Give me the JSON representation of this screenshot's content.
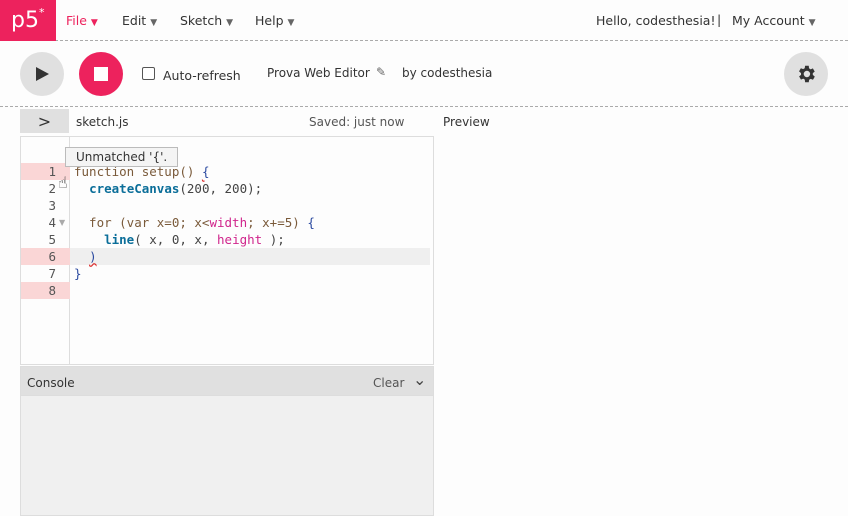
{
  "nav": {
    "logo": "p5",
    "logo_star": "*",
    "menus": [
      "File",
      "Edit",
      "Sketch",
      "Help"
    ],
    "hello": "Hello, codesthesia!",
    "separator": "|",
    "account": "My Account"
  },
  "toolbar": {
    "auto_refresh": "Auto-refresh",
    "auto_refresh_checked": false,
    "project_name": "Prova Web Editor",
    "by": "by codesthesia"
  },
  "editor": {
    "toggle": ">",
    "file_name": "sketch.js",
    "saved": "Saved: just now",
    "preview": "Preview",
    "tooltip": "Unmatched '{'.",
    "error_lines": [
      1,
      6,
      8
    ],
    "highlight_line": 6,
    "lines": [
      [
        {
          "t": "function setup() ",
          "c": "kw"
        },
        {
          "t": "{",
          "c": "br err"
        }
      ],
      [
        {
          "t": "  "
        },
        {
          "t": "createCanvas",
          "c": "fn"
        },
        {
          "t": "(200, 200);",
          "c": "plain"
        }
      ],
      [],
      [
        {
          "t": "  for (var x=0; x<",
          "c": "kw"
        },
        {
          "t": "width",
          "c": "var"
        },
        {
          "t": "; x+=5) ",
          "c": "kw"
        },
        {
          "t": "{",
          "c": "br"
        }
      ],
      [
        {
          "t": "    "
        },
        {
          "t": "line",
          "c": "fn"
        },
        {
          "t": "( x, 0, x, ",
          "c": "plain"
        },
        {
          "t": "height",
          "c": "var"
        },
        {
          "t": " );",
          "c": "plain"
        }
      ],
      [
        {
          "t": "  "
        },
        {
          "t": ")",
          "c": "br err"
        }
      ],
      [
        {
          "t": "}",
          "c": "br"
        }
      ],
      []
    ]
  },
  "console": {
    "title": "Console",
    "clear": "Clear"
  }
}
